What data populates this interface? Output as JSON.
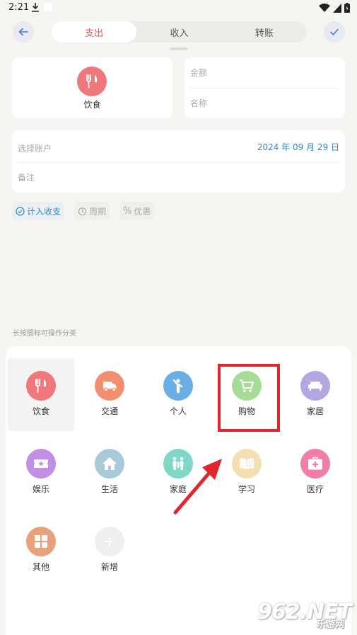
{
  "status_bar": {
    "time": "2:21"
  },
  "tabs": [
    {
      "label": "支出",
      "active": true
    },
    {
      "label": "收入",
      "active": false
    },
    {
      "label": "转账",
      "active": false
    }
  ],
  "selected_category": {
    "label": "饮食",
    "icon": "fork-knife-icon",
    "color": "#f0787a"
  },
  "form": {
    "amount_placeholder": "金额",
    "name_placeholder": "名称",
    "account_placeholder": "选择账户",
    "date": "2024 年 09 月 29 日",
    "note_placeholder": "备注"
  },
  "chips": [
    {
      "label": "计入收支",
      "icon": "check-circle-icon",
      "on": true
    },
    {
      "label": "周期",
      "icon": "cycle-icon",
      "on": false
    },
    {
      "label": "优惠",
      "icon": "percent-icon",
      "on": false
    }
  ],
  "hint": "长按图标可操作分类",
  "categories": [
    {
      "label": "饮食",
      "icon": "fork-knife-icon",
      "color": "#f0787a"
    },
    {
      "label": "交通",
      "icon": "bus-icon",
      "color": "#f38e6e"
    },
    {
      "label": "个人",
      "icon": "person-icon",
      "color": "#6aaee6"
    },
    {
      "label": "购物",
      "icon": "cart-icon",
      "color": "#a6dc96"
    },
    {
      "label": "家居",
      "icon": "sofa-icon",
      "color": "#b4a6e0"
    },
    {
      "label": "娱乐",
      "icon": "ticket-icon",
      "color": "#c28ee6"
    },
    {
      "label": "生活",
      "icon": "house-icon",
      "color": "#a8cad8"
    },
    {
      "label": "家庭",
      "icon": "family-icon",
      "color": "#7fd7c8"
    },
    {
      "label": "学习",
      "icon": "book-icon",
      "color": "#f3dfb0"
    },
    {
      "label": "医疗",
      "icon": "medkit-icon",
      "color": "#f07ea8"
    },
    {
      "label": "其他",
      "icon": "grid-icon",
      "color": "#e7a27c"
    },
    {
      "label": "新增",
      "icon": "plus-icon",
      "color": "#efefef"
    }
  ],
  "watermark": {
    "big": "962.NET",
    "small": "乐游网"
  }
}
